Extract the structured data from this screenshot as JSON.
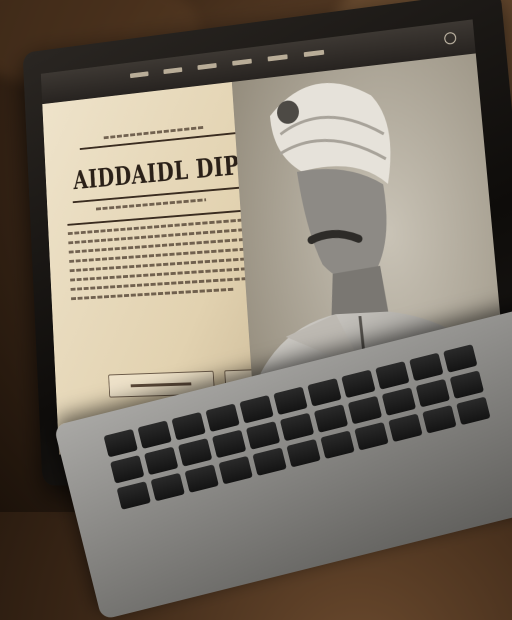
{
  "site": {
    "title": "AIDDAIDL DIPIAI"
  },
  "colors": {
    "paper": "#e6d7b8",
    "ink": "#2a2018",
    "topbar": "#2f2a26",
    "desk_fabric": "#4a3220"
  },
  "icons": {
    "settings": "gear-icon"
  }
}
